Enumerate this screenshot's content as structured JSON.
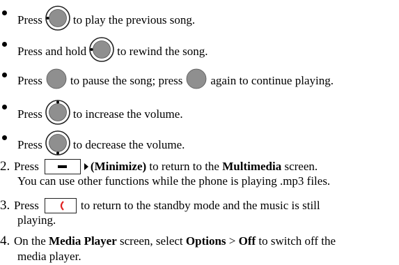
{
  "bullets": [
    {
      "pre": "Press",
      "post": "to play the previous song.",
      "icon": "pad-left-icon"
    },
    {
      "pre": "Press and hold",
      "post": "to rewind the song.",
      "icon": "pad-left-icon"
    },
    {
      "pre": "Press",
      "mid": "to pause the song; press",
      "post": "again to continue playing.",
      "icon": "pad-center-icon"
    },
    {
      "pre": "Press",
      "post": "to increase the volume.",
      "icon": "pad-up-icon"
    },
    {
      "pre": "Press",
      "post": "to decrease the volume.",
      "icon": "pad-down-icon"
    }
  ],
  "steps": [
    {
      "num": "2.",
      "pre": "Press",
      "b1": "(Minimize)",
      "mid": "to return to the",
      "b2": "Multimedia",
      "post": "screen.",
      "line2": "You can use other functions while the phone is playing .mp3 files.",
      "icon": "minimize-key-icon"
    },
    {
      "num": "3.",
      "pre": "Press",
      "post": "to return to the standby mode and the music is still",
      "line2": "playing.",
      "icon": "end-call-key-icon"
    },
    {
      "num": "4.",
      "pre": "On the",
      "b1": "Media Player",
      "mid": "screen, select",
      "b2": "Options",
      "sep": ">",
      "b3": "Off",
      "post": "to switch off the",
      "line2": "media player."
    }
  ]
}
